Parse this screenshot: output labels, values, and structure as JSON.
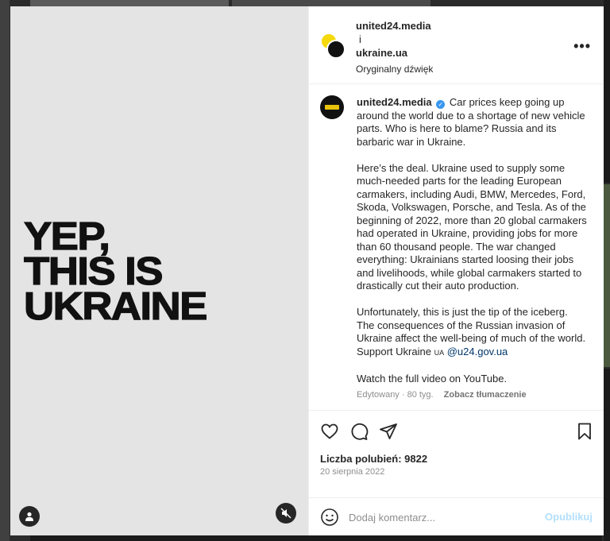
{
  "poster": {
    "line1": "YEP,",
    "line2": "THIS IS",
    "line3": "UKRAINE"
  },
  "header": {
    "author1": "united24.media",
    "connector": "i",
    "author2": "ukraine.ua",
    "audio": "Oryginalny dźwięk",
    "more_label": "•••"
  },
  "caption": {
    "username": "united24.media",
    "verified_mark": "✓",
    "p1": "Car prices keep going up around the world due to a shortage of new vehicle parts. Who is here to blame? Russia and its barbaric war in Ukraine.",
    "p2": "Here’s the deal. Ukraine used to supply some much-needed parts for the leading European carmakers, including Audi, BMW, Mercedes, Ford, Skoda, Volkswagen, Porsche, and Tesla. As of the beginning of 2022, more than 20 global carmakers had operated in Ukraine, providing jobs for more than 60 thousand people. The war changed everything: Ukrainians started loosing their jobs and livelihoods, while global carmakers started to drastically cut their auto production.",
    "p3": "Unfortunately, this is just the tip of the iceberg. The consequences of the Russian invasion of Ukraine affect the well-being of much of the world.",
    "support_text": "Support Ukraine",
    "support_flag": "UA",
    "support_link": "@u24.gov.ua",
    "p4": "Watch the full video on YouTube.",
    "meta_edited": "Edytowany · 80 tyg.",
    "meta_translate": "Zobacz tłumaczenie"
  },
  "icons": {
    "like": "heart-icon",
    "comment": "comment-icon",
    "share": "paper-plane-icon",
    "save": "bookmark-icon",
    "user_tag": "user-icon",
    "mute": "muted-speaker-icon",
    "emoji": "smiley-icon"
  },
  "stats": {
    "likes": "Liczba polubień: 9822",
    "date": "20 sierpnia 2022"
  },
  "comment": {
    "placeholder": "Dodaj komentarz...",
    "post_label": "Opublikuj"
  }
}
